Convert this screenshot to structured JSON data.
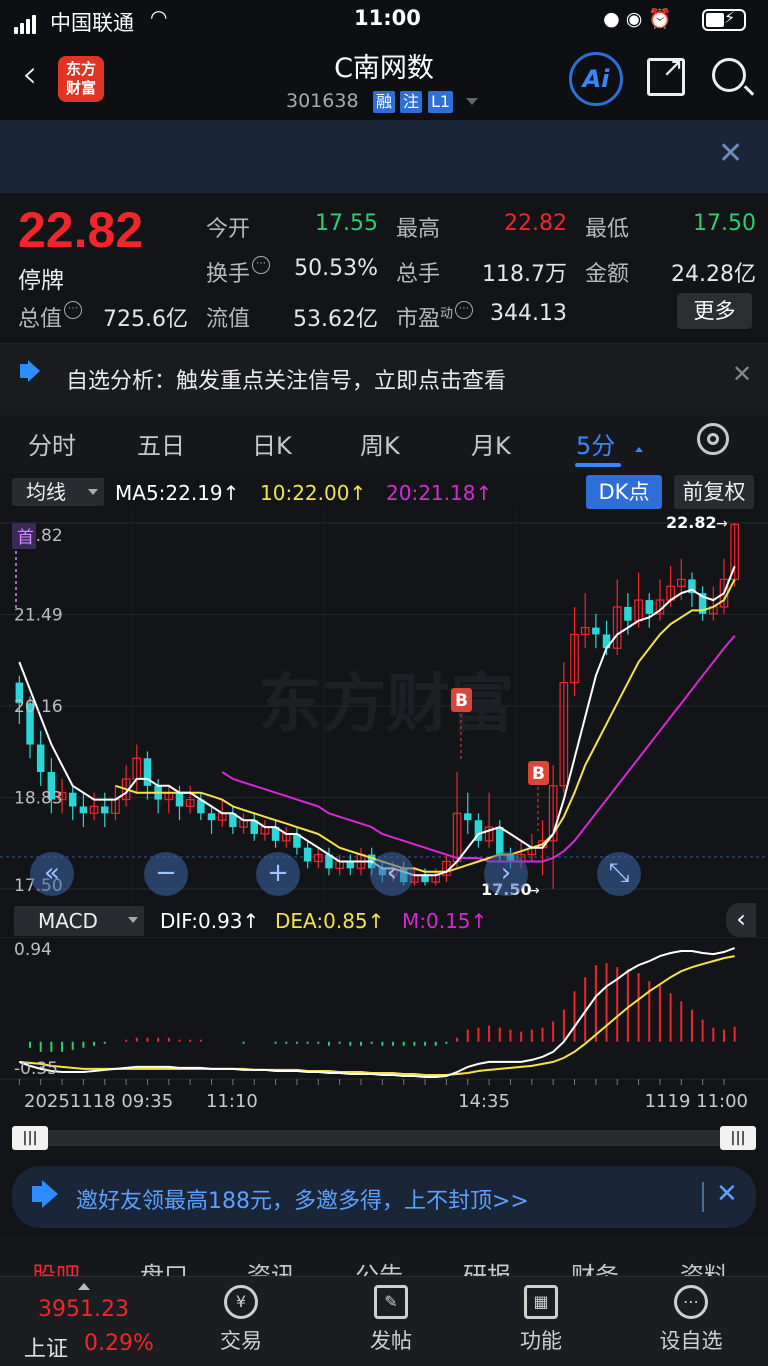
{
  "status": {
    "carrier": "中国联通",
    "time": "11:00"
  },
  "nav": {
    "title": "C南网数",
    "code": "301638",
    "tags": [
      "融",
      "注",
      "L1"
    ],
    "logo": [
      "东方",
      "财富"
    ],
    "ai": "Ai"
  },
  "quote": {
    "price": "22.82",
    "state": "停牌",
    "open_label": "今开",
    "open": "17.55",
    "high_label": "最高",
    "high": "22.82",
    "low_label": "最低",
    "low": "17.50",
    "turnover_label": "换手",
    "turnover": "50.53%",
    "volume_label": "总手",
    "volume": "118.7万",
    "amount_label": "金额",
    "amount": "24.28亿",
    "mktcap_label": "总值",
    "mktcap": "725.6亿",
    "float_label": "流值",
    "float": "53.62亿",
    "pe_label": "市盈",
    "pe_sup": "动",
    "pe": "344.13",
    "more": "更多"
  },
  "notice": {
    "text": "自选分析：触发重点关注信号，立即点击查看"
  },
  "tabs": [
    "分时",
    "五日",
    "日K",
    "周K",
    "月K",
    "5分"
  ],
  "chart_header": {
    "indicator": "均线",
    "ma5": "MA5:22.19",
    "ma10": "10:22.00",
    "ma20": "20:21.18",
    "dk": "DK点",
    "adjust": "前复权"
  },
  "price_axis": [
    "22.82",
    "21.49",
    "20.16",
    "18.83",
    "17.50"
  ],
  "chart_labels": {
    "first_mark": "首",
    "b_marker": "B",
    "high_marker": "22.82",
    "low_marker": "17.50",
    "watermark": "东方财富"
  },
  "macd_header": {
    "indicator": "MACD",
    "dif": "DIF:0.93",
    "dea": "DEA:0.85",
    "m": "M:0.15"
  },
  "macd_axis": [
    "0.94",
    "-0.35"
  ],
  "time_axis": [
    "20251118 09:35",
    "11:10",
    "14:35",
    "1119 11:00"
  ],
  "invite": {
    "text": "邀好友领最高188元，多邀多得，上不封顶>>"
  },
  "subtabs": [
    "股吧",
    "盘口",
    "资讯",
    "公告",
    "研报",
    "财务",
    "资料"
  ],
  "bottom": {
    "index_value": "3951.23",
    "index_name": "上证",
    "index_pct": "0.29%",
    "items": [
      "交易",
      "发帖",
      "功能",
      "设自选"
    ]
  },
  "colors": {
    "up": "#f0262b",
    "down": "#2bd6d6",
    "ma5": "#ffffff",
    "ma10": "#f2e34a",
    "ma20": "#d629d6",
    "accent": "#3a86ff"
  },
  "chart_data": {
    "type": "candlestick",
    "ylim": [
      17.5,
      22.82
    ],
    "candles": [
      [
        20.5,
        20.2,
        20.6,
        19.9
      ],
      [
        20.2,
        19.6,
        20.3,
        19.4
      ],
      [
        19.6,
        19.2,
        19.8,
        19.0
      ],
      [
        19.2,
        18.8,
        19.4,
        18.6
      ],
      [
        18.8,
        18.9,
        19.1,
        18.6
      ],
      [
        18.9,
        18.7,
        19.0,
        18.5
      ],
      [
        18.7,
        18.6,
        18.9,
        18.4
      ],
      [
        18.6,
        18.7,
        18.9,
        18.5
      ],
      [
        18.7,
        18.6,
        18.9,
        18.4
      ],
      [
        18.6,
        18.8,
        19.0,
        18.5
      ],
      [
        18.8,
        19.1,
        19.3,
        18.7
      ],
      [
        19.1,
        19.4,
        19.6,
        18.9
      ],
      [
        19.4,
        19.0,
        19.5,
        18.8
      ],
      [
        19.0,
        18.8,
        19.1,
        18.6
      ],
      [
        18.8,
        18.9,
        19.0,
        18.6
      ],
      [
        18.9,
        18.7,
        19.0,
        18.5
      ],
      [
        18.7,
        18.8,
        19.0,
        18.6
      ],
      [
        18.8,
        18.6,
        18.9,
        18.5
      ],
      [
        18.6,
        18.5,
        18.7,
        18.3
      ],
      [
        18.5,
        18.6,
        18.8,
        18.4
      ],
      [
        18.6,
        18.4,
        18.7,
        18.3
      ],
      [
        18.4,
        18.5,
        18.6,
        18.3
      ],
      [
        18.5,
        18.3,
        18.6,
        18.2
      ],
      [
        18.3,
        18.4,
        18.5,
        18.2
      ],
      [
        18.4,
        18.2,
        18.5,
        18.1
      ],
      [
        18.2,
        18.3,
        18.4,
        18.1
      ],
      [
        18.3,
        18.1,
        18.4,
        18.0
      ],
      [
        18.1,
        17.9,
        18.2,
        17.8
      ],
      [
        17.9,
        18.0,
        18.1,
        17.8
      ],
      [
        18.0,
        17.8,
        18.1,
        17.7
      ],
      [
        17.8,
        17.9,
        18.0,
        17.7
      ],
      [
        17.9,
        17.8,
        18.0,
        17.7
      ],
      [
        17.8,
        18.0,
        18.1,
        17.7
      ],
      [
        18.0,
        17.8,
        18.1,
        17.7
      ],
      [
        17.8,
        17.7,
        17.9,
        17.6
      ],
      [
        17.7,
        17.8,
        17.9,
        17.6
      ],
      [
        17.8,
        17.6,
        17.9,
        17.55
      ],
      [
        17.6,
        17.7,
        17.8,
        17.55
      ],
      [
        17.7,
        17.6,
        17.8,
        17.55
      ],
      [
        17.6,
        17.7,
        17.8,
        17.55
      ],
      [
        17.7,
        17.9,
        18.0,
        17.6
      ],
      [
        17.9,
        18.6,
        19.2,
        17.8
      ],
      [
        18.6,
        18.5,
        18.9,
        18.3
      ],
      [
        18.5,
        18.2,
        18.6,
        18.1
      ],
      [
        18.2,
        18.4,
        18.9,
        18.1
      ],
      [
        18.4,
        18.0,
        18.5,
        17.9
      ],
      [
        18.0,
        17.9,
        18.1,
        17.8
      ],
      [
        17.9,
        18.0,
        18.2,
        17.8
      ],
      [
        18.0,
        18.1,
        18.3,
        17.9
      ],
      [
        18.1,
        18.2,
        18.5,
        17.7
      ],
      [
        18.2,
        19.0,
        19.3,
        17.5
      ],
      [
        19.0,
        20.5,
        20.8,
        18.9
      ],
      [
        20.5,
        21.2,
        21.6,
        20.3
      ],
      [
        21.2,
        21.3,
        21.8,
        21.0
      ],
      [
        21.3,
        21.2,
        21.5,
        21.0
      ],
      [
        21.2,
        21.0,
        21.4,
        20.9
      ],
      [
        21.0,
        21.6,
        22.0,
        20.9
      ],
      [
        21.6,
        21.4,
        21.8,
        21.2
      ],
      [
        21.4,
        21.7,
        22.1,
        21.3
      ],
      [
        21.7,
        21.5,
        21.8,
        21.3
      ],
      [
        21.5,
        21.7,
        22.0,
        21.4
      ],
      [
        21.7,
        21.9,
        22.2,
        21.6
      ],
      [
        21.9,
        22.0,
        22.3,
        21.7
      ],
      [
        22.0,
        21.8,
        22.1,
        21.6
      ],
      [
        21.8,
        21.5,
        21.9,
        21.4
      ],
      [
        21.5,
        21.6,
        21.9,
        21.4
      ],
      [
        21.6,
        22.0,
        22.3,
        21.5
      ],
      [
        22.0,
        22.8,
        22.82,
        21.9
      ]
    ],
    "ma5": [
      20.8,
      20.4,
      20.0,
      19.6,
      19.3,
      19.0,
      18.9,
      18.8,
      18.8,
      18.8,
      18.9,
      19.1,
      19.1,
      19.0,
      19.0,
      18.9,
      18.9,
      18.8,
      18.7,
      18.6,
      18.6,
      18.5,
      18.5,
      18.4,
      18.4,
      18.3,
      18.3,
      18.2,
      18.1,
      18.0,
      17.9,
      17.9,
      17.9,
      17.9,
      17.8,
      17.8,
      17.75,
      17.7,
      17.7,
      17.7,
      17.75,
      17.9,
      18.1,
      18.3,
      18.35,
      18.4,
      18.3,
      18.2,
      18.1,
      18.1,
      18.3,
      18.8,
      19.4,
      20.0,
      20.6,
      21.0,
      21.2,
      21.3,
      21.4,
      21.45,
      21.55,
      21.7,
      21.8,
      21.85,
      21.75,
      21.7,
      21.8,
      22.19
    ],
    "ma10": [
      null,
      null,
      null,
      null,
      null,
      null,
      null,
      null,
      null,
      19.0,
      18.95,
      18.9,
      18.9,
      18.9,
      18.9,
      18.9,
      18.9,
      18.9,
      18.85,
      18.8,
      18.7,
      18.65,
      18.6,
      18.55,
      18.5,
      18.45,
      18.4,
      18.35,
      18.3,
      18.2,
      18.1,
      18.05,
      18.0,
      17.95,
      17.9,
      17.85,
      17.8,
      17.8,
      17.75,
      17.75,
      17.75,
      17.8,
      17.85,
      17.9,
      17.95,
      18.0,
      18.0,
      18.05,
      18.1,
      18.15,
      18.3,
      18.55,
      18.9,
      19.3,
      19.6,
      19.9,
      20.2,
      20.5,
      20.8,
      21.0,
      21.2,
      21.35,
      21.45,
      21.55,
      21.55,
      21.6,
      21.7,
      22.0
    ],
    "ma20": [
      null,
      null,
      null,
      null,
      null,
      null,
      null,
      null,
      null,
      null,
      null,
      null,
      null,
      null,
      null,
      null,
      null,
      null,
      null,
      19.2,
      19.1,
      19.05,
      19.0,
      18.95,
      18.9,
      18.85,
      18.8,
      18.75,
      18.7,
      18.6,
      18.55,
      18.5,
      18.45,
      18.4,
      18.3,
      18.25,
      18.2,
      18.15,
      18.1,
      18.05,
      18.0,
      17.95,
      17.95,
      17.95,
      17.9,
      17.9,
      17.9,
      17.9,
      17.9,
      17.9,
      17.95,
      18.05,
      18.2,
      18.4,
      18.6,
      18.8,
      19.0,
      19.2,
      19.4,
      19.6,
      19.8,
      20.0,
      20.2,
      20.4,
      20.6,
      20.8,
      21.0,
      21.18
    ],
    "macd": {
      "ylim": [
        -0.35,
        0.94
      ],
      "dif": [
        -0.2,
        -0.24,
        -0.27,
        -0.29,
        -0.3,
        -0.3,
        -0.3,
        -0.29,
        -0.28,
        -0.27,
        -0.26,
        -0.25,
        -0.25,
        -0.25,
        -0.25,
        -0.26,
        -0.26,
        -0.26,
        -0.27,
        -0.27,
        -0.27,
        -0.28,
        -0.28,
        -0.28,
        -0.29,
        -0.29,
        -0.29,
        -0.3,
        -0.3,
        -0.31,
        -0.31,
        -0.32,
        -0.32,
        -0.32,
        -0.33,
        -0.33,
        -0.34,
        -0.34,
        -0.35,
        -0.35,
        -0.34,
        -0.3,
        -0.25,
        -0.22,
        -0.2,
        -0.2,
        -0.2,
        -0.2,
        -0.18,
        -0.15,
        -0.1,
        0.0,
        0.15,
        0.3,
        0.45,
        0.55,
        0.62,
        0.7,
        0.76,
        0.8,
        0.85,
        0.88,
        0.9,
        0.9,
        0.88,
        0.87,
        0.89,
        0.93
      ],
      "dea": [
        -0.2,
        -0.21,
        -0.22,
        -0.24,
        -0.25,
        -0.26,
        -0.27,
        -0.27,
        -0.27,
        -0.27,
        -0.27,
        -0.27,
        -0.27,
        -0.27,
        -0.27,
        -0.27,
        -0.27,
        -0.27,
        -0.27,
        -0.27,
        -0.27,
        -0.27,
        -0.28,
        -0.28,
        -0.28,
        -0.28,
        -0.28,
        -0.29,
        -0.29,
        -0.29,
        -0.3,
        -0.3,
        -0.3,
        -0.31,
        -0.31,
        -0.31,
        -0.32,
        -0.32,
        -0.33,
        -0.33,
        -0.33,
        -0.32,
        -0.31,
        -0.29,
        -0.28,
        -0.27,
        -0.26,
        -0.25,
        -0.24,
        -0.22,
        -0.2,
        -0.16,
        -0.1,
        -0.02,
        0.07,
        0.16,
        0.25,
        0.34,
        0.42,
        0.5,
        0.57,
        0.64,
        0.7,
        0.74,
        0.77,
        0.8,
        0.83,
        0.85
      ],
      "hist": [
        0.0,
        -0.06,
        -0.1,
        -0.1,
        -0.1,
        -0.08,
        -0.06,
        -0.04,
        -0.02,
        0.0,
        0.02,
        0.04,
        0.04,
        0.04,
        0.04,
        0.02,
        0.02,
        0.02,
        0.0,
        0.0,
        0.0,
        -0.02,
        0.0,
        0.0,
        -0.02,
        -0.02,
        -0.02,
        -0.02,
        -0.02,
        -0.04,
        -0.02,
        -0.04,
        -0.04,
        -0.02,
        -0.04,
        -0.04,
        -0.04,
        -0.04,
        -0.04,
        -0.04,
        -0.02,
        0.04,
        0.12,
        0.14,
        0.16,
        0.14,
        0.12,
        0.1,
        0.12,
        0.14,
        0.2,
        0.32,
        0.5,
        0.64,
        0.76,
        0.78,
        0.74,
        0.72,
        0.68,
        0.6,
        0.56,
        0.48,
        0.4,
        0.32,
        0.22,
        0.14,
        0.12,
        0.15
      ]
    }
  }
}
